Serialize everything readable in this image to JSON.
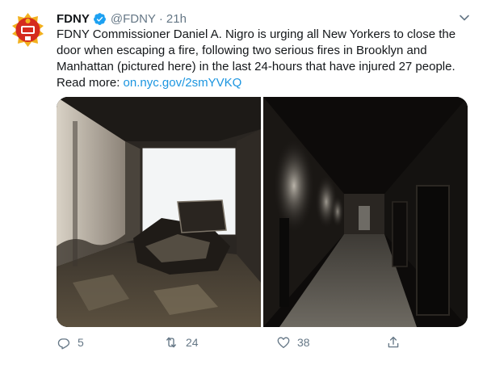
{
  "tweet": {
    "display_name": "FDNY",
    "handle": "@FDNY",
    "separator": "·",
    "time": "21h",
    "text_before_link": "FDNY Commissioner Daniel A. Nigro is urging all New Yorkers to close the door when escaping a fire, following two serious fires in Brooklyn and Manhattan (pictured here) in the last 24-hours that have injured 27 people. Read more: ",
    "link_text": "on.nyc.gov/2smYVKQ"
  },
  "actions": {
    "replies": "5",
    "retweets": "24",
    "likes": "38"
  },
  "icons": {
    "avatar": "fdny-logo",
    "verified": "verified-badge-icon",
    "caret": "chevron-down-icon",
    "reply": "reply-icon",
    "retweet": "retweet-icon",
    "like": "heart-icon",
    "share": "share-icon"
  },
  "colors": {
    "accent": "#1b95e0",
    "muted": "#657786",
    "text": "#14171a",
    "logo_red": "#d52b1e",
    "logo_gold": "#f2b01e"
  }
}
